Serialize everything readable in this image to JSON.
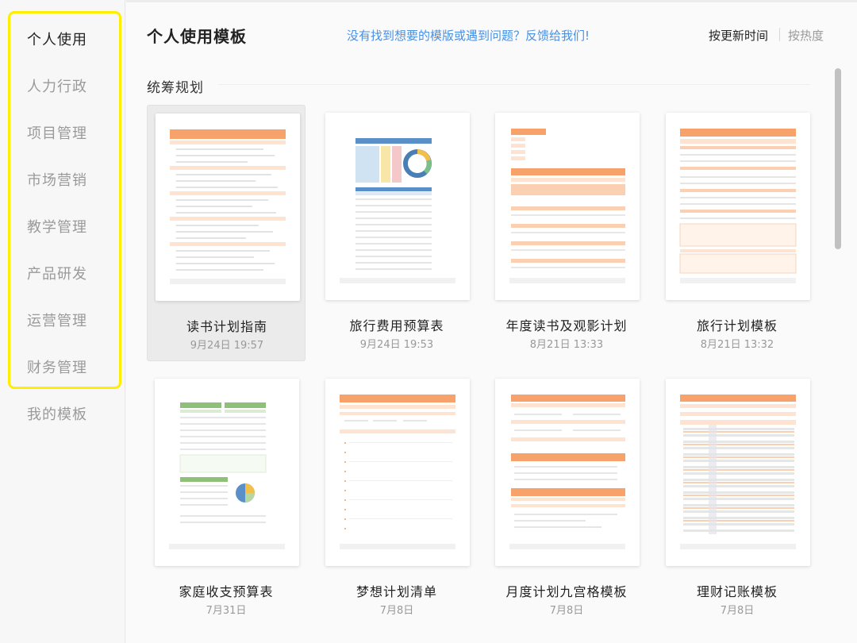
{
  "sidebar": {
    "items": [
      {
        "label": "个人使用",
        "active": true
      },
      {
        "label": "人力行政",
        "active": false
      },
      {
        "label": "项目管理",
        "active": false
      },
      {
        "label": "市场营销",
        "active": false
      },
      {
        "label": "教学管理",
        "active": false
      },
      {
        "label": "产品研发",
        "active": false
      },
      {
        "label": "运营管理",
        "active": false
      },
      {
        "label": "财务管理",
        "active": false
      },
      {
        "label": "我的模板",
        "active": false
      }
    ]
  },
  "header": {
    "title": "个人使用模板",
    "feedback_link": "没有找到想要的模版或遇到问题？反馈给我们!",
    "sort_by_update": "按更新时间",
    "sort_by_hot": "按热度"
  },
  "section": {
    "title": "统筹规划"
  },
  "templates": [
    {
      "title": "读书计划指南",
      "date": "9月24日 19:57",
      "selected": true,
      "thumb_icon": "reading-plan-sheet-icon"
    },
    {
      "title": "旅行费用预算表",
      "date": "9月24日 19:53",
      "selected": false,
      "thumb_icon": "travel-budget-sheet-icon"
    },
    {
      "title": "年度读书及观影计划",
      "date": "8月21日 13:33",
      "selected": false,
      "thumb_icon": "annual-reading-sheet-icon"
    },
    {
      "title": "旅行计划模板",
      "date": "8月21日 13:32",
      "selected": false,
      "thumb_icon": "travel-plan-sheet-icon"
    },
    {
      "title": "家庭收支预算表",
      "date": "7月31日",
      "selected": false,
      "thumb_icon": "family-budget-sheet-icon"
    },
    {
      "title": "梦想计划清单",
      "date": "7月8日",
      "selected": false,
      "thumb_icon": "dream-list-sheet-icon"
    },
    {
      "title": "月度计划九宫格模板",
      "date": "7月8日",
      "selected": false,
      "thumb_icon": "monthly-grid-sheet-icon"
    },
    {
      "title": "理财记账模板",
      "date": "7月8日",
      "selected": false,
      "thumb_icon": "finance-ledger-sheet-icon"
    }
  ],
  "colors": {
    "accent_link": "#4a90e2",
    "highlight_border": "#ffee00",
    "sheet_orange": "#f6a26a",
    "sheet_orange_light": "#fde3d0",
    "sheet_green": "#8fc07a",
    "sheet_blue": "#5a8fc8"
  }
}
